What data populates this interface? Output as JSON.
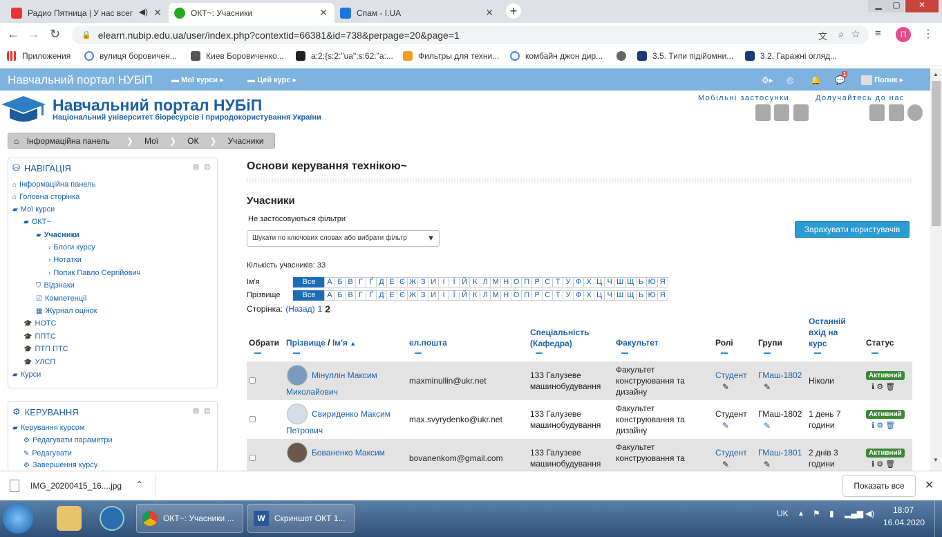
{
  "browser": {
    "tabs": [
      {
        "title": "Радио Пятница | У нас всег",
        "color": "#e33"
      },
      {
        "title": "ОКТ~: Учасники",
        "color": "#3a3"
      },
      {
        "title": "Спам - I.UA",
        "color": "#1d74e0"
      }
    ],
    "url": "elearn.nubip.edu.ua/user/index.php?contextid=66381&id=738&perpage=20&page=1",
    "profile_letter": "П",
    "bookmarks": [
      "Приложения",
      "вулиця боровичен...",
      "Киев Боровиченко...",
      "a:2:{s:2:\"ua\";s:62:\"a:...",
      "Фильтры для техни...",
      "комбайн джон дир...",
      "",
      "3.5. Типи підійомни...",
      "3.2. Гаражні огляд..."
    ]
  },
  "navbar": {
    "brand": "Навчальний портал НУБіП",
    "menu1": "Мої курси",
    "menu2": "Цей курс",
    "msg_count": "1",
    "user": "Попик"
  },
  "header": {
    "title": "Навчальний портал НУБіП",
    "subtitle": "Національний університет біоресурсів і природокористування України",
    "mobile": "Мобільні застосунки",
    "join": "Долучайтесь до нас"
  },
  "breadcrumb": [
    "Інформаційна панель",
    "Мої",
    "ОК",
    "Учасники"
  ],
  "nav_block": {
    "title": "НАВІГАЦІЯ",
    "items": [
      "Інформаційна панель",
      "Головна сторінка",
      "Мої курси",
      "ОКТ~",
      "Учасники",
      "Блоги курсу",
      "Нотатки",
      "Попик Павло Сергійович",
      "Відзнаки",
      "Компетенції",
      "Журнал оцінок",
      "НОТС",
      "ППТС",
      "ПТП ПТС",
      "УЛСП",
      "Курси"
    ]
  },
  "admin_block": {
    "title": "КЕРУВАННЯ",
    "items": [
      "Керування курсом",
      "Редагувати параметри",
      "Редагувати",
      "Завершення курсу"
    ]
  },
  "main": {
    "course_title": "Основи керування технікою~",
    "section": "Учасники",
    "filter_note": "Не застосовуються фільтри",
    "filter_placeholder": "Шукати по ключових словах або вибрати фільтр",
    "enrol_button": "Зарахувати користувачів",
    "count": "Кількість учасників: 33",
    "firstname_label": "Ім'я",
    "lastname_label": "Прізвище",
    "all": "Все",
    "letters": [
      "А",
      "Б",
      "В",
      "Г",
      "Ґ",
      "Д",
      "Е",
      "Є",
      "Ж",
      "З",
      "И",
      "І",
      "Ї",
      "Й",
      "К",
      "Л",
      "М",
      "Н",
      "О",
      "П",
      "Р",
      "С",
      "Т",
      "У",
      "Ф",
      "Х",
      "Ц",
      "Ч",
      "Ш",
      "Щ",
      "Ь",
      "Ю",
      "Я"
    ],
    "page_label": "Сторінка:",
    "page_back": "(Назад)",
    "page_1": "1",
    "page_2": "2",
    "columns": {
      "select": "Обрати",
      "surname": "Прізвище",
      "slash": "/",
      "name": "Ім'я",
      "email": "ел.пошта",
      "spec1": "Спеціальність",
      "spec2": "(Кафедра)",
      "faculty": "Факультет",
      "roles": "Ролі",
      "groups": "Групи",
      "last1": "Останній",
      "last2": "вхід на",
      "last3": "курс",
      "status": "Статус"
    },
    "rows": [
      {
        "name1": "Мінуллін Максим",
        "name2": "Миколайович",
        "email": "maxminullin@ukr.net",
        "spec1": "133 Галузеве",
        "spec2": "машинобудування",
        "fac1": "Факультет",
        "fac2": "конструювання та",
        "fac3": "дизайну",
        "role": "Студент",
        "group": "ГМаш-1802",
        "last1": "Ніколи",
        "last2": "",
        "status": "Активний"
      },
      {
        "name1": "Свириденко Максим",
        "name2": "Петрович",
        "email": "max.svyrydenko@ukr.net",
        "spec1": "133 Галузеве",
        "spec2": "машинобудування",
        "fac1": "Факультет",
        "fac2": "конструювання та",
        "fac3": "дизайну",
        "role": "Студент",
        "group": "ГМаш-1802",
        "last1": "1 день 7",
        "last2": "години",
        "status": "Активний"
      },
      {
        "name1": "Бованенко Максим",
        "name2": "",
        "email": "bovanenkom@gmail.com",
        "spec1": "133 Галузеве",
        "spec2": "машинобудування",
        "fac1": "Факультет",
        "fac2": "конструювання та",
        "fac3": "",
        "role": "Студент",
        "group": "ГМаш-1801",
        "last1": "2 днів 3",
        "last2": "години",
        "status": "Активний"
      }
    ]
  },
  "download": {
    "file": "IMG_20200415_16....jpg",
    "show_all": "Показать все"
  },
  "taskbar": {
    "task1": "ОКТ~: Учасники ...",
    "task2": "Скриншот ОКТ 1...",
    "lang": "UK",
    "time": "18:07",
    "date": "16.04.2020"
  }
}
